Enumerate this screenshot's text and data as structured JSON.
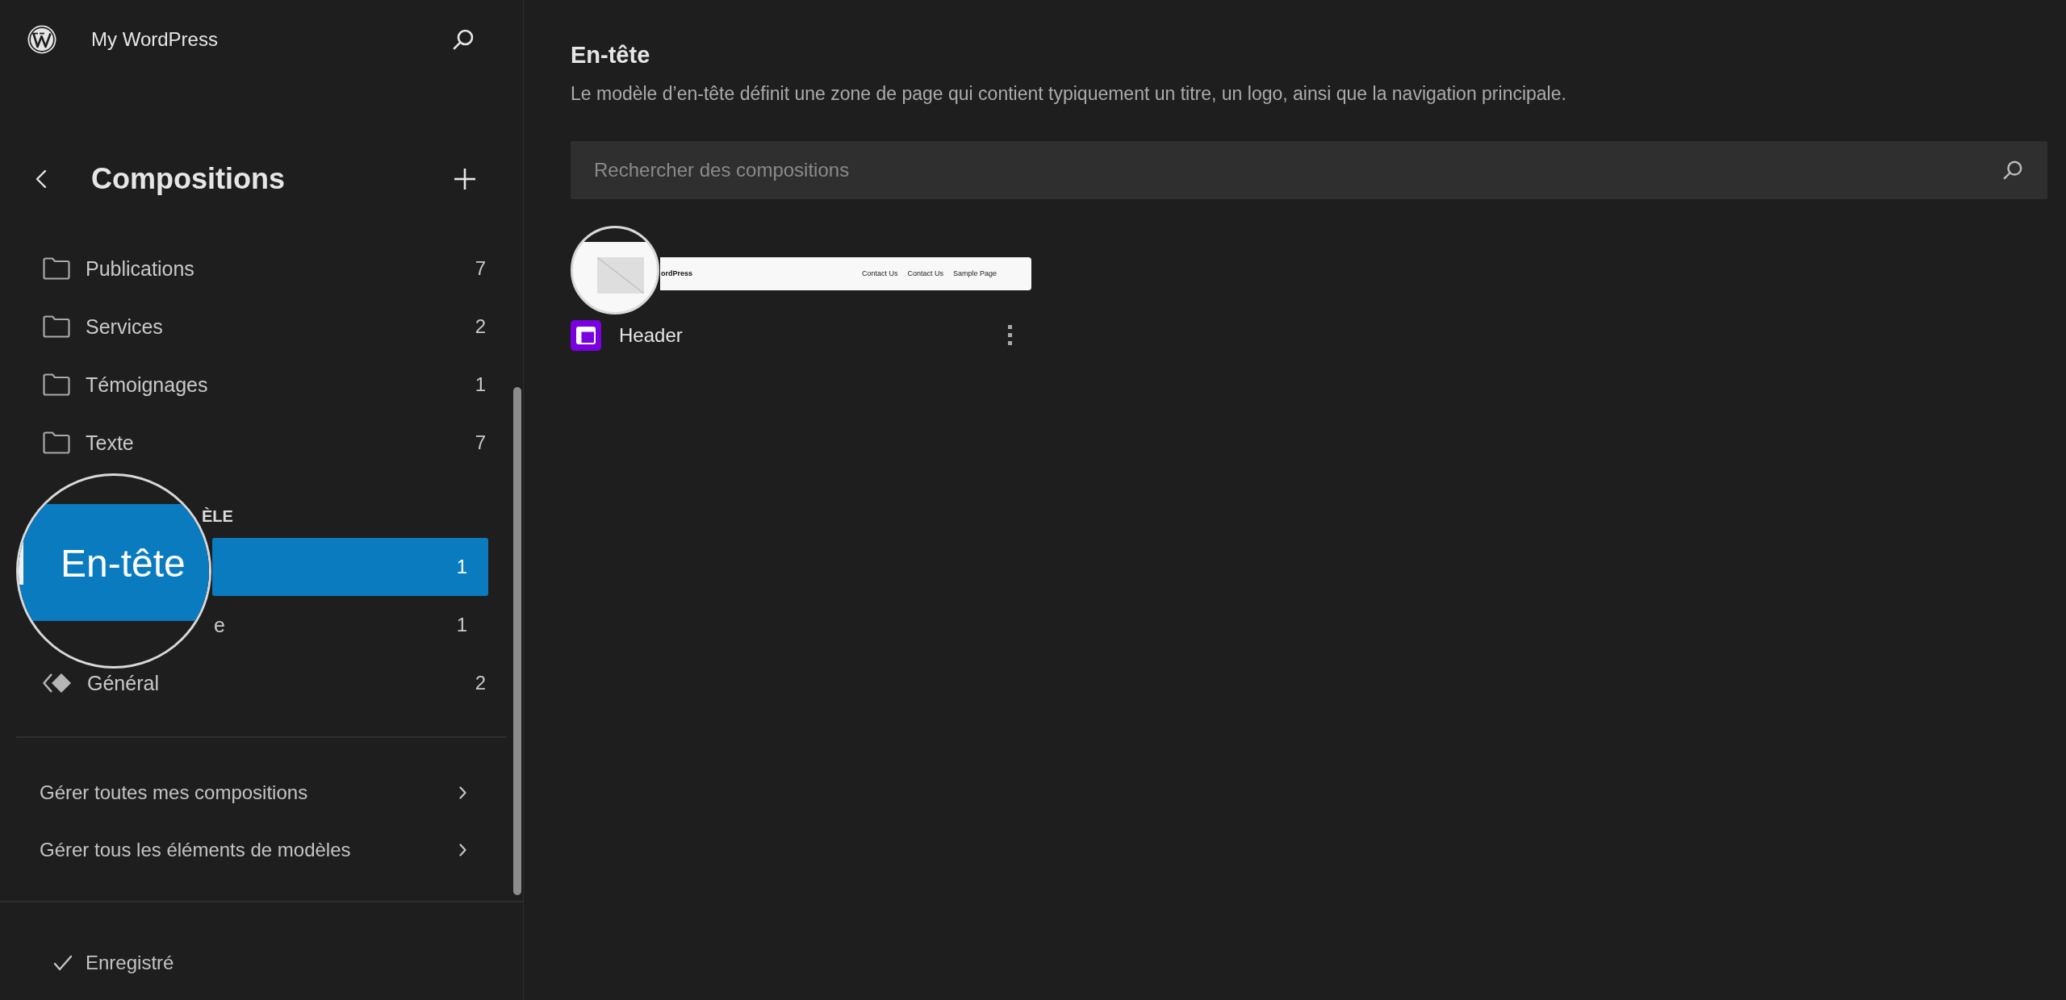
{
  "sidebar": {
    "site_title": "My WordPress",
    "title": "Compositions",
    "categories": [
      {
        "label": "Publications",
        "count": "7",
        "selected": false
      },
      {
        "label": "Services",
        "count": "2",
        "selected": false
      },
      {
        "label": "Témoignages",
        "count": "1",
        "selected": false
      },
      {
        "label": "Texte",
        "count": "7",
        "selected": false
      }
    ],
    "template_parts": {
      "heading": "ÈLE",
      "magnifier": {
        "text": "En-tête"
      },
      "items": [
        {
          "kind": "covered",
          "count": "1",
          "selected": true
        },
        {
          "kind": "covered",
          "label": "e",
          "count": "1",
          "selected": false
        },
        {
          "kind": "general",
          "label": "Général",
          "count": "2",
          "selected": false
        }
      ]
    },
    "links": [
      "Gérer toutes mes compositions",
      "Gérer tous les éléments de modèles"
    ],
    "status": "Enregistré"
  },
  "main": {
    "title": "En-tête",
    "description": "Le modèle d’en-tête définit une zone de page qui contient typiquement un titre, un logo, ainsi que la navigation principale.",
    "search": {
      "placeholder": "Rechercher des compositions"
    },
    "patterns": [
      {
        "title": "Header",
        "preview": {
          "site_title": "ordPress",
          "nav": [
            "Contact Us",
            "Contact Us",
            "Sample Page"
          ]
        }
      }
    ]
  }
}
